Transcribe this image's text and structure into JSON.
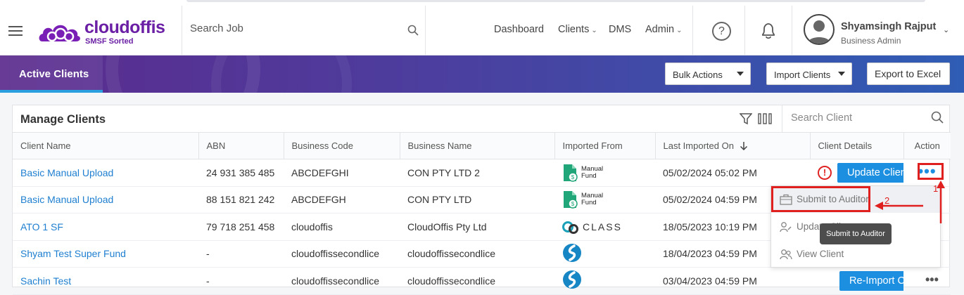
{
  "app": {
    "logo_text": "cloudoffis",
    "logo_sub": "SMSF Sorted",
    "search_placeholder": "Search Job"
  },
  "nav": [
    {
      "label": "Dashboard"
    },
    {
      "label": "Clients"
    },
    {
      "label": "DMS"
    },
    {
      "label": "Admin"
    }
  ],
  "user": {
    "name": "Shyamsingh Rajput",
    "role": "Business Admin"
  },
  "banner": {
    "tab": "Active Clients",
    "bulk_actions": "Bulk Actions",
    "import_clients": "Import Clients",
    "export_excel": "Export to Excel"
  },
  "card": {
    "title": "Manage Clients",
    "search_placeholder": "Search Client"
  },
  "table": {
    "headers": [
      "Client Name",
      "ABN",
      "Business Code",
      "Business Name",
      "Imported From",
      "Last Imported On",
      "Client Details",
      "Action"
    ],
    "rows": [
      {
        "client": "Basic Manual Upload",
        "abn": "24 931 385 485",
        "code": "ABCDEFGHI",
        "business": "CON PTY LTD 2",
        "source": "Manual Fund",
        "date": "05/02/2024 05:02 PM",
        "details_btn": "Update Client"
      },
      {
        "client": "Basic Manual Upload",
        "abn": "88 151 821 242",
        "code": "ABCDEFGH",
        "business": "CON PTY LTD",
        "source": "Manual Fund",
        "date": "05/02/2024 04:59 PM",
        "details_btn": ""
      },
      {
        "client": "ATO 1 SF",
        "abn": "79 718 251 458",
        "code": "cloudoffis",
        "business": "CloudOffis Pty Ltd",
        "source": "CLASS",
        "date": "18/05/2023 10:19 PM",
        "details_btn": ""
      },
      {
        "client": "Shyam Test Super Fund",
        "abn": "-",
        "code": "cloudoffissecondlice",
        "business": "cloudoffissecondlice",
        "source": "",
        "date": "18/04/2023 04:59 PM",
        "details_btn": ""
      },
      {
        "client": "Sachin Test",
        "abn": "-",
        "code": "cloudoffissecondlice",
        "business": "cloudoffissecondlice",
        "source": "",
        "date": "03/04/2023 04:59 PM",
        "details_btn": "Re-Import Client"
      }
    ]
  },
  "action_menu": {
    "submit": "Submit to Auditor",
    "update": "Update Client",
    "view": "View Client",
    "tooltip": "Submit to Auditor"
  },
  "annotations": {
    "step1": "1",
    "step2": "2"
  },
  "colors": {
    "brand": "#6a1fa5",
    "primary": "#1d8fe1",
    "annotation": "#e01f1f"
  }
}
